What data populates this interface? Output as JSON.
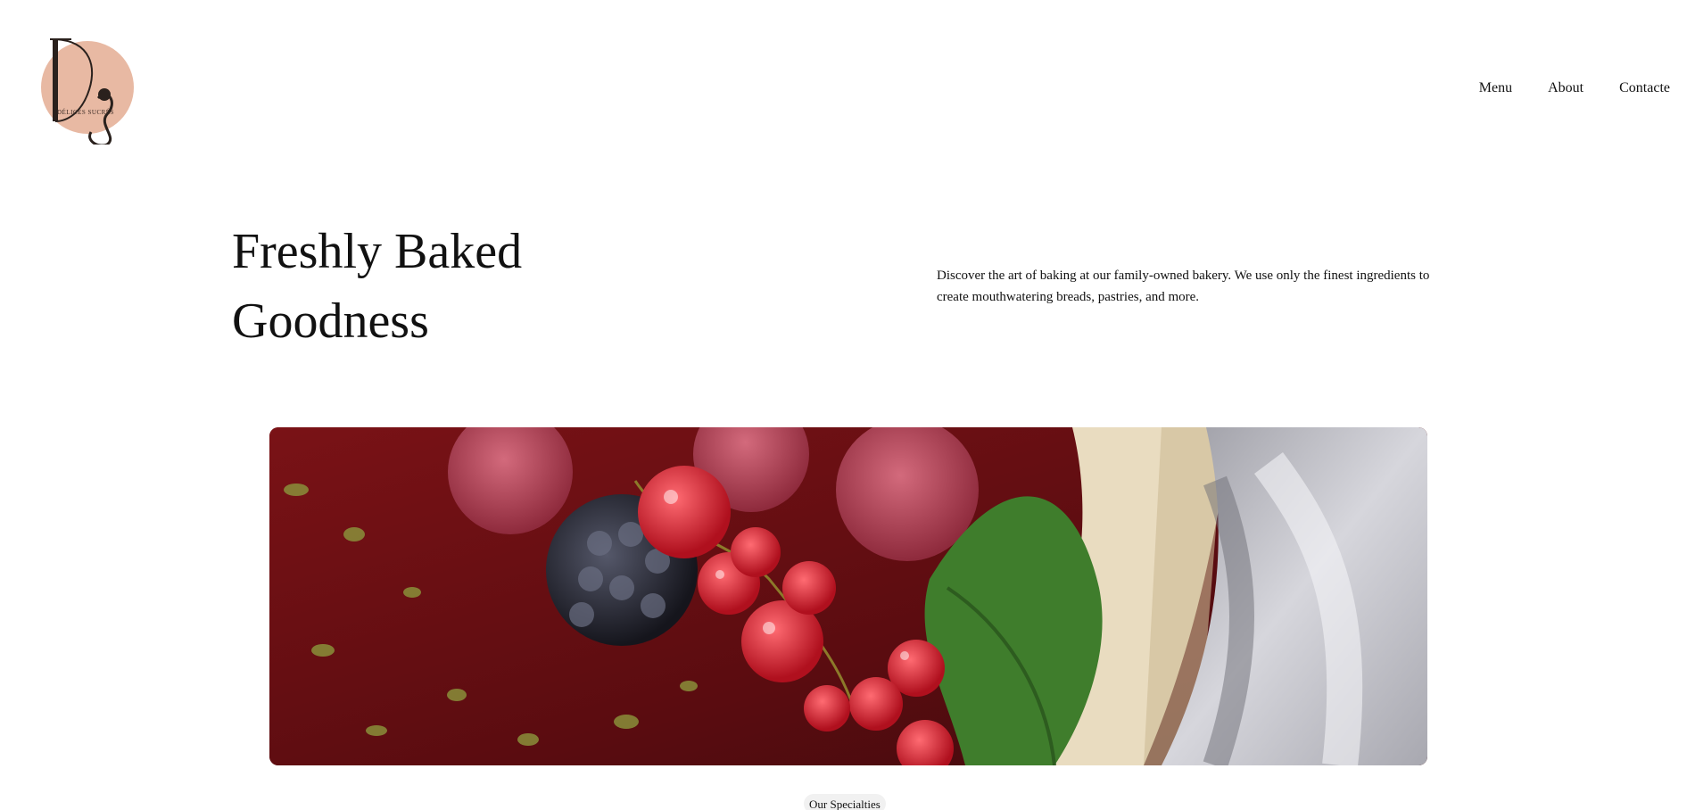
{
  "brand": {
    "logo_initials": "DS",
    "logo_text": "DÉLICES SUCRÉS",
    "logo_color": "#e8b9a3"
  },
  "nav": {
    "items": [
      {
        "label": "Menu"
      },
      {
        "label": "About"
      },
      {
        "label": "Contacte"
      }
    ]
  },
  "hero": {
    "title_line1": "Freshly Baked",
    "title_line2": "Goodness",
    "description": "Discover the art of baking at our family-owned bakery. We use only the finest ingredients to create mouthwatering breads, pastries, and more."
  },
  "hero_image": {
    "subject": "berries-dessert-photo",
    "colors": {
      "sauce": "#6b0f12",
      "raspberry": "#b23a4e",
      "currant": "#d92a3a",
      "leaf": "#3f7d2c",
      "cloth": "#c9c9cf"
    }
  },
  "section": {
    "label": "Our Specialties"
  }
}
